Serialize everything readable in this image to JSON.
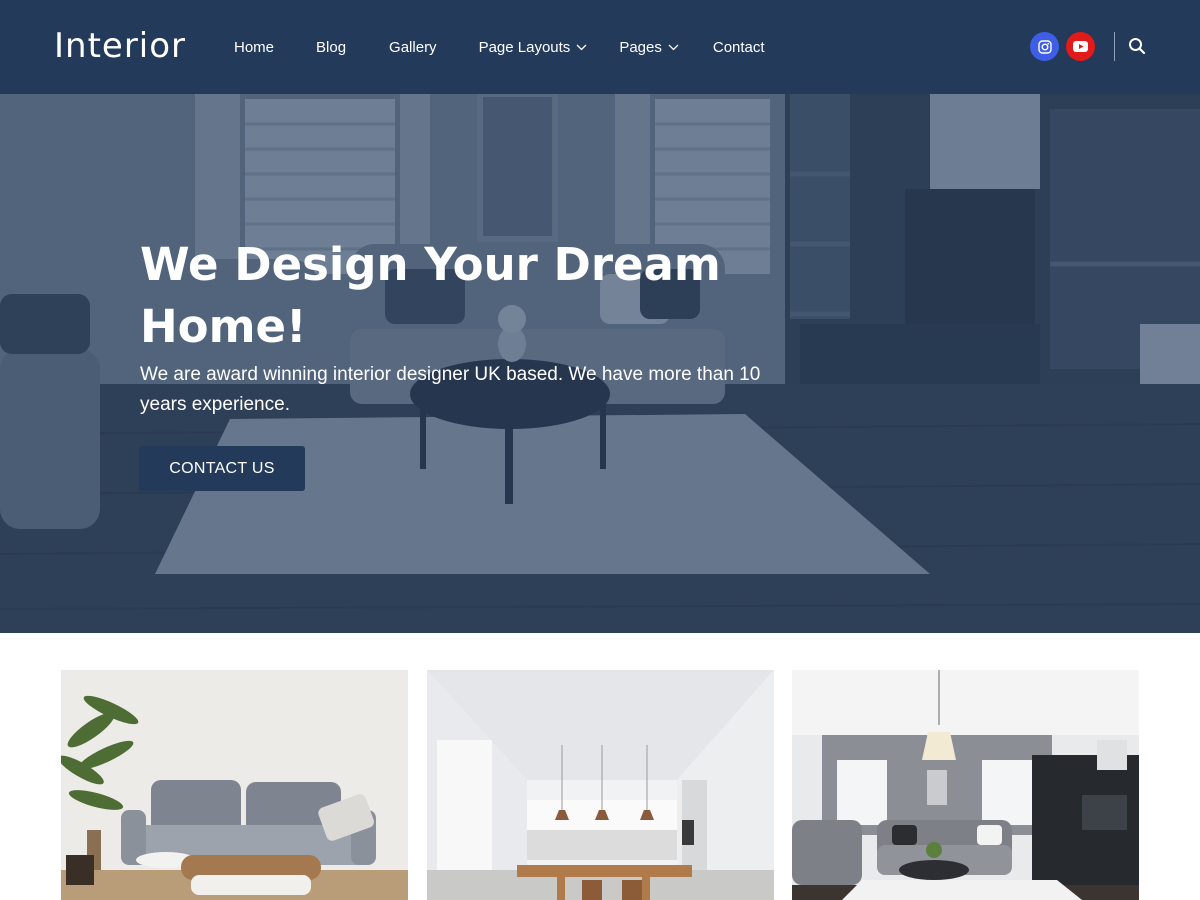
{
  "header": {
    "logo": "Interior",
    "nav": [
      {
        "label": "Home",
        "dropdown": false
      },
      {
        "label": "Blog",
        "dropdown": false
      },
      {
        "label": "Gallery",
        "dropdown": false
      },
      {
        "label": "Page Layouts",
        "dropdown": true
      },
      {
        "label": "Pages",
        "dropdown": true
      },
      {
        "label": "Contact",
        "dropdown": false
      }
    ],
    "social": [
      {
        "icon": "instagram-icon",
        "color": "#3f5ee6"
      },
      {
        "icon": "youtube-icon",
        "color": "#e11a1a"
      }
    ],
    "search_icon": "search-icon"
  },
  "hero": {
    "title": "We Design Your Dream Home!",
    "subtitle": "We are award winning interior designer UK based. We have more than 10 years experience.",
    "cta_label": "CONTACT US",
    "image": "living-room-photo"
  },
  "cards": [
    {
      "image": "sofa-room-photo"
    },
    {
      "image": "kitchen-dining-photo"
    },
    {
      "image": "lounge-photo"
    }
  ],
  "colors": {
    "brand": "#233a5a",
    "instagram": "#3f5ee6",
    "youtube": "#e11a1a",
    "text_light": "#ffffff"
  }
}
